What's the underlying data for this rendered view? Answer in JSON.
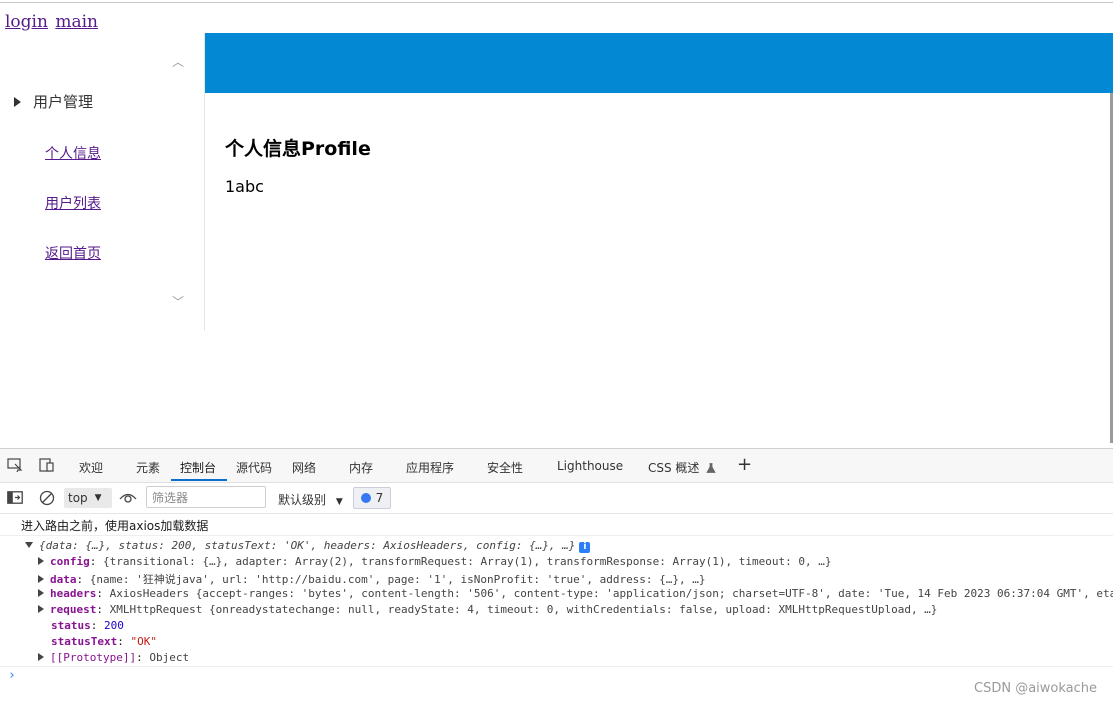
{
  "router": {
    "login": "login",
    "main": "main"
  },
  "sidebar": {
    "scroll_up": "︿",
    "scroll_down": "﹀",
    "menu_title": "用户管理",
    "items": [
      {
        "label": "个人信息"
      },
      {
        "label": "用户列表"
      },
      {
        "label": "返回首页"
      }
    ]
  },
  "header": {
    "bar_color": "#0389d4"
  },
  "main": {
    "title": "个人信息Profile",
    "body": "1abc"
  },
  "devtools": {
    "tabs": [
      "欢迎",
      "元素",
      "控制台",
      "源代码",
      "网络",
      "内存",
      "应用程序",
      "安全性",
      "Lighthouse",
      "CSS 概述"
    ],
    "active_tab": "控制台",
    "add_tab": "+",
    "context": "top",
    "filter_placeholder": "筛选器",
    "levels": "默认级别",
    "message_count": "7",
    "log_text": "进入路由之前，使用axios加载数据",
    "object_summary": "{data: {…}, status: 200, statusText: 'OK', headers: AxiosHeaders, config: {…}, …}",
    "info_badge": "i",
    "props": {
      "config": {
        "key": "config",
        "value": "{transitional: {…}, adapter: Array(2), transformRequest: Array(1), transformResponse: Array(1), timeout: 0, …}"
      },
      "data": {
        "key": "data",
        "value": "{name: '狂神说java', url: 'http://baidu.com', page: '1', isNonProfit: 'true', address: {…}, …}"
      },
      "headers": {
        "key": "headers",
        "value": "AxiosHeaders {accept-ranges: 'bytes', content-length: '506', content-type: 'application/json; charset=UTF-8', date: 'Tue, 14 Feb 2023 06:37:04 GMT', eta"
      },
      "request": {
        "key": "request",
        "value": "XMLHttpRequest {onreadystatechange: null, readyState: 4, timeout: 0, withCredentials: false, upload: XMLHttpRequestUpload, …}"
      },
      "status": {
        "key": "status",
        "value": "200"
      },
      "statusText": {
        "key": "statusText",
        "value": "\"OK\""
      },
      "prototype": {
        "key": "[[Prototype]]",
        "value": "Object"
      }
    },
    "prompt": "›"
  },
  "watermark": "CSDN @aiwokache"
}
